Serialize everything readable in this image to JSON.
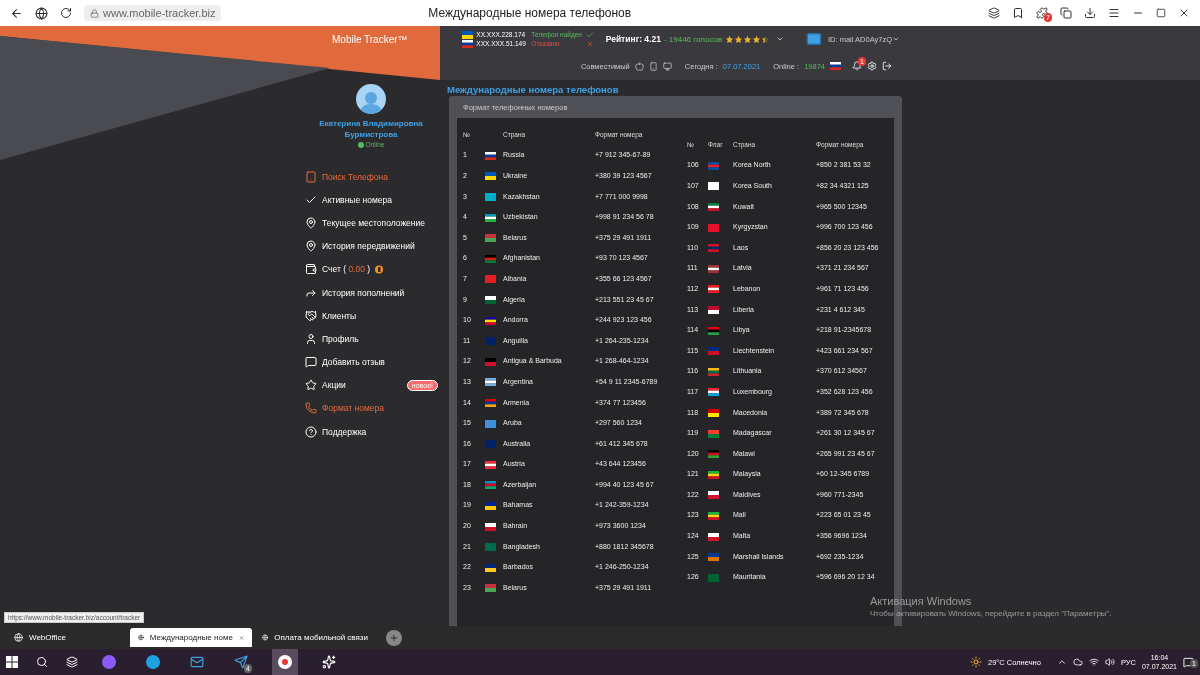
{
  "browser": {
    "url": "www.mobile-tracker.biz",
    "title": "Международные номера телефонов",
    "notification_count": "7"
  },
  "header": {
    "logo": "Mobile Tracker™",
    "ips": [
      {
        "ip": "XX.XXX.228.174",
        "status": "Телефон найден",
        "ok": true
      },
      {
        "ip": "XXX.XXX.51.149",
        "status": "Отказано",
        "ok": false
      }
    ],
    "rating_label": "Рейтинг: 4.21",
    "votes": "- 19446 голосов",
    "stars": 4.5,
    "account_id": "ID: mail AD0Ay7zQ",
    "compatible": "Совместимый",
    "today_label": "Сегодня :",
    "today": "07.07.2021",
    "online_label": "Online :",
    "online": "19874",
    "bell_count": "1"
  },
  "profile": {
    "name": "Екатерина Владимировна Бурмистрова",
    "status": "Online"
  },
  "menu": [
    {
      "label": "Поиск Телефона",
      "highlighted": true
    },
    {
      "label": "Активные номера",
      "highlighted": false
    },
    {
      "label": "Текущее местоположение",
      "highlighted": false
    },
    {
      "label": "История передвижений",
      "highlighted": false
    },
    {
      "label": "Счет (",
      "amount": "0.00",
      "suffix": ")",
      "highlighted": false
    },
    {
      "label": "История пополнений",
      "highlighted": false
    },
    {
      "label": "Клиенты",
      "highlighted": false
    },
    {
      "label": "Профиль",
      "highlighted": false
    },
    {
      "label": "Добавить отзыв",
      "highlighted": false
    },
    {
      "label": "Акции",
      "badge": "новое!",
      "highlighted": false
    },
    {
      "label": "Формат номера",
      "highlighted": true
    },
    {
      "label": "Поддержка",
      "highlighted": false
    }
  ],
  "main": {
    "title": "Международные номера телефонов",
    "card_title": "Формат телефонных номеров",
    "tables": [
      {
        "headers": {
          "number": "№",
          "country": "Страна",
          "format": "Формат номера"
        },
        "rows": [
          {
            "n": "1",
            "country": "Russia",
            "format": "+7 912 345-67-89"
          },
          {
            "n": "2",
            "country": "Ukraine",
            "format": "+380 39 123 4567"
          },
          {
            "n": "3",
            "country": "Kazakhstan",
            "format": "+7 771 000 9998"
          },
          {
            "n": "4",
            "country": "Uzbekistan",
            "format": "+998 91 234 56 78"
          },
          {
            "n": "5",
            "country": "Belarus",
            "format": "+375 29 491 1911"
          },
          {
            "n": "6",
            "country": "Afghanistan",
            "format": "+93 70 123 4567"
          },
          {
            "n": "7",
            "country": "Albania",
            "format": "+355 66 123 4567"
          },
          {
            "n": "9",
            "country": "Algeria",
            "format": "+213 551 23 45 67"
          },
          {
            "n": "10",
            "country": "Andorra",
            "format": "+244 923 123 456"
          },
          {
            "n": "11",
            "country": "Anguilla",
            "format": "+1 264-235-1234"
          },
          {
            "n": "12",
            "country": "Antigua & Barbuda",
            "format": "+1 268-464-1234"
          },
          {
            "n": "13",
            "country": "Argentina",
            "format": "+54 9 11 2345-6789"
          },
          {
            "n": "14",
            "country": "Armenia",
            "format": "+374 77 123456"
          },
          {
            "n": "15",
            "country": "Aruba",
            "format": "+297 560 1234"
          },
          {
            "n": "16",
            "country": "Australia",
            "format": "+61 412 345 678"
          },
          {
            "n": "17",
            "country": "Austria",
            "format": "+43 644 123456"
          },
          {
            "n": "18",
            "country": "Azerbaijan",
            "format": "+994 40 123 45 67"
          },
          {
            "n": "19",
            "country": "Bahamas",
            "format": "+1 242-359-1234"
          },
          {
            "n": "20",
            "country": "Bahrain",
            "format": "+973 3600 1234"
          },
          {
            "n": "21",
            "country": "Bangladesh",
            "format": "+880 1812 345678"
          },
          {
            "n": "22",
            "country": "Barbados",
            "format": "+1 246-250-1234"
          },
          {
            "n": "23",
            "country": "Belarus",
            "format": "+375 29 491 1911"
          }
        ]
      },
      {
        "headers": {
          "number": "№",
          "flag": "Флаг",
          "country": "Страна",
          "format": "Формат номера"
        },
        "rows": [
          {
            "n": "106",
            "country": "Korea North",
            "format": "+850 2 381 53 32"
          },
          {
            "n": "107",
            "country": "Korea South",
            "format": "+82 34 4321 125"
          },
          {
            "n": "108",
            "country": "Kuwait",
            "format": "+965 500 12345"
          },
          {
            "n": "109",
            "country": "Kyrgyzstan",
            "format": "+996 700 123 456"
          },
          {
            "n": "110",
            "country": "Laos",
            "format": "+856 20 23 123 456"
          },
          {
            "n": "111",
            "country": "Latvia",
            "format": "+371 21 234 567"
          },
          {
            "n": "112",
            "country": "Lebanon",
            "format": "+961 71 123 456"
          },
          {
            "n": "113",
            "country": "Liberia",
            "format": "+231 4 612 345"
          },
          {
            "n": "114",
            "country": "Libya",
            "format": "+218 91-2345678"
          },
          {
            "n": "115",
            "country": "Liechtenstein",
            "format": "+423 661 234 567"
          },
          {
            "n": "116",
            "country": "Lithuania",
            "format": "+370 612 34567"
          },
          {
            "n": "117",
            "country": "Luxembourg",
            "format": "+352 628 123 456"
          },
          {
            "n": "118",
            "country": "Macedonia",
            "format": "+389 72 345 678"
          },
          {
            "n": "119",
            "country": "Madagascar",
            "format": "+261 30 12 345 67"
          },
          {
            "n": "120",
            "country": "Malawi",
            "format": "+265 991 23 45 67"
          },
          {
            "n": "121",
            "country": "Malaysia",
            "format": "+60 12-345 6789"
          },
          {
            "n": "122",
            "country": "Maldives",
            "format": "+960 771-2345"
          },
          {
            "n": "123",
            "country": "Mali",
            "format": "+223 65 01 23 45"
          },
          {
            "n": "124",
            "country": "Malta",
            "format": "+356 9696 1234"
          },
          {
            "n": "125",
            "country": "Marshall Islands",
            "format": "+692 235-1234"
          },
          {
            "n": "126",
            "country": "Mauritania",
            "format": "+596 696 20 12 34"
          }
        ]
      }
    ]
  },
  "status_url": "https://www.mobile-tracker.biz/account/tracker",
  "activation": {
    "title": "Активация Windows",
    "text": "Чтобы активировать Windows, перейдите в раздел \"Параметры\"."
  },
  "browser_tabs": [
    {
      "label": "WebOffice",
      "selected": false
    },
    {
      "label": "Международные номе",
      "selected": true
    },
    {
      "label": "Оплата мобильной связи",
      "selected": false
    }
  ],
  "taskbar": {
    "telegram_count": "4",
    "weather": "29°C Солнечно",
    "language": "РУС",
    "time": "16:04",
    "date": "07.07.2021",
    "notifications": "1"
  }
}
